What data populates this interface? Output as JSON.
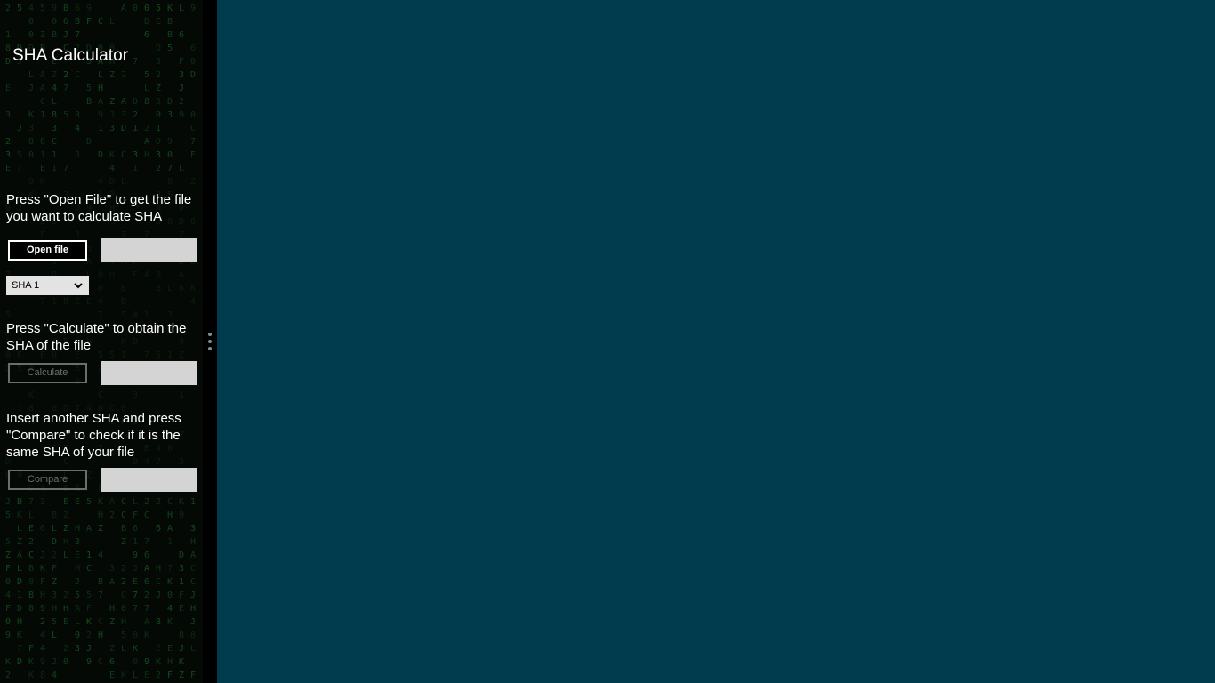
{
  "app": {
    "title": "SHA Calculator"
  },
  "open_section": {
    "instruction": "Press \"Open File\" to get the file you want to calculate SHA",
    "button_label": "Open file",
    "file_field_value": ""
  },
  "algorithm": {
    "selected": "SHA 1"
  },
  "calculate_section": {
    "instruction": "Press \"Calculate\" to obtain the SHA of the file",
    "button_label": "Calculate",
    "result_field_value": ""
  },
  "compare_section": {
    "instruction": "Insert another SHA and press \"Compare\" to check if it is the same SHA of your file",
    "button_label": "Compare",
    "input_value": ""
  },
  "colors": {
    "desktop_background": "#003c4e",
    "panel_background": "#050905",
    "matrix_glyph": "#1f7a2e",
    "field_background": "#d4d4d4",
    "disabled_border": "#6b6f6b"
  },
  "icons": {
    "dropdown": "chevron-down-icon",
    "splitter": "grip-dots-icon"
  }
}
